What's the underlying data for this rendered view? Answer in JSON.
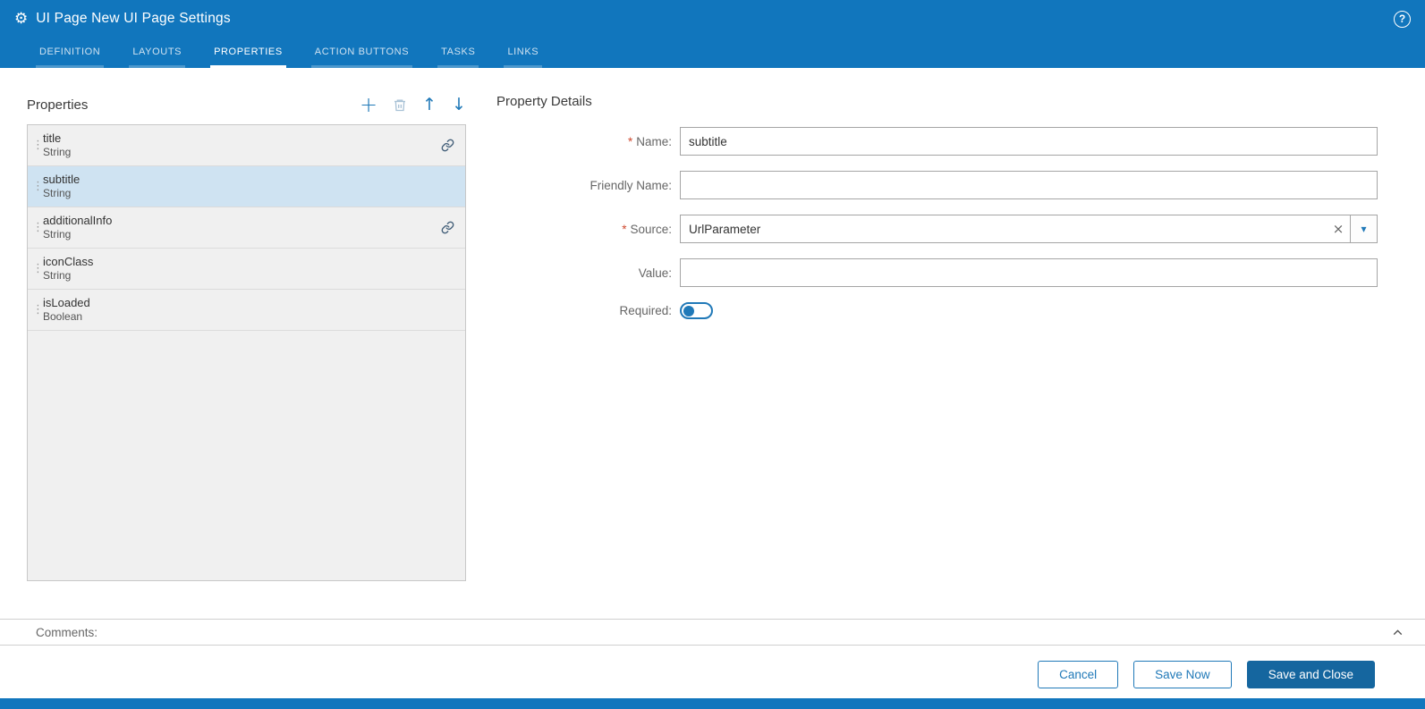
{
  "header": {
    "title": "UI Page New UI Page Settings"
  },
  "icons": {
    "gear": "⚙",
    "help": "?",
    "add": "+",
    "move_up": "↑",
    "move_down": "↓",
    "drag_handle": "⋮",
    "clear": "×",
    "dropdown": "▾"
  },
  "tabs": [
    {
      "label": "DEFINITION"
    },
    {
      "label": "LAYOUTS"
    },
    {
      "label": "PROPERTIES"
    },
    {
      "label": "ACTION BUTTONS"
    },
    {
      "label": "TASKS"
    },
    {
      "label": "LINKS"
    }
  ],
  "properties_panel": {
    "title": "Properties",
    "items": [
      {
        "name": "title",
        "type": "String"
      },
      {
        "name": "subtitle",
        "type": "String"
      },
      {
        "name": "additionalInfo",
        "type": "String"
      },
      {
        "name": "iconClass",
        "type": "String"
      },
      {
        "name": "isLoaded",
        "type": "Boolean"
      }
    ]
  },
  "details_panel": {
    "title": "Property Details",
    "required_marker": "*",
    "fields": {
      "name": {
        "label": "Name:",
        "value": "subtitle"
      },
      "friendly_name": {
        "label": "Friendly Name:",
        "value": ""
      },
      "source": {
        "label": "Source:",
        "value": "UrlParameter"
      },
      "value": {
        "label": "Value:",
        "value": ""
      },
      "required": {
        "label": "Required:",
        "state": "off"
      }
    }
  },
  "comments": {
    "label": "Comments:"
  },
  "footer": {
    "cancel_label": "Cancel",
    "save_now_label": "Save Now",
    "save_and_close_label": "Save and Close"
  },
  "colors": {
    "header_blue": "#1176bd",
    "accent_blue": "#2079b8",
    "selected_row": "#cfe3f2",
    "primary_button": "#15669f",
    "required_red": "#cf4a30"
  }
}
